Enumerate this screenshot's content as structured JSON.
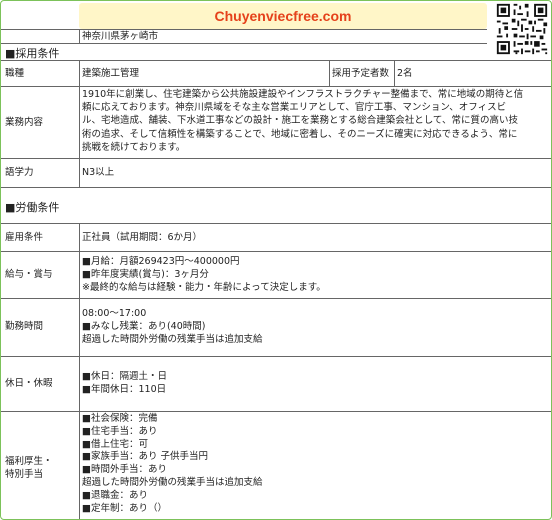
{
  "banner": {
    "site": "Chuyenviecfree.com"
  },
  "location": "神奈川県茅ヶ崎市",
  "sections": {
    "recruit": "■採用条件",
    "work": "■労働条件"
  },
  "rows": {
    "job_type": {
      "label": "職種",
      "value": "建築施工管理",
      "count_label": "採用予定者数",
      "count_value": "2名"
    },
    "business": {
      "label": "業務内容",
      "lines": [
        "1910年に創業し、住宅建築から公共施設建設やインフラストラクチャー整備まで、常に地域の期待と信",
        "頼に応えております。神奈川県域をそな主な営業エリアとして、官庁工事、マンション、オフィスビ",
        "ル、宅地造成、舗装、下水道工事などの設計・施工を業務とする総合建築会社として、常に質の高い技",
        "術の追求、そして信頼性を構築することで、地域に密着し、そのニーズに確実に対応できるよう、常に",
        "挑戦を続けております。"
      ]
    },
    "language": {
      "label": "語学力",
      "value": "N3以上"
    },
    "employment": {
      "label": "雇用条件",
      "value": "正社員（試用期間：6か月）"
    },
    "salary": {
      "label": "給与・賞与",
      "lines": [
        "■月給：月額269423円～400000円",
        "■昨年度実績(賞与)：3ヶ月分",
        "※最終的な給与は経験・能力・年齢によって決定します。"
      ]
    },
    "hours": {
      "label": "勤務時間",
      "lines": [
        "08:00～17:00",
        "■みなし残業：あり(40時間)",
        "超過した時間外労働の残業手当は追加支給"
      ]
    },
    "holidays": {
      "label": "休日・休暇",
      "lines": [
        "■休日：隔週土・日",
        "■年間休日：110日"
      ]
    },
    "welfare": {
      "label1": "福利厚生・",
      "label2": "特別手当",
      "lines": [
        "■社会保険：完備",
        "■住宅手当：あり",
        "■借上住宅：可",
        "■家族手当：あり 子供手当円",
        "■時間外手当：あり",
        "超過した時間外労働の残業手当は追加支給",
        "■退職金：あり",
        "■定年制：あり（）"
      ]
    }
  }
}
